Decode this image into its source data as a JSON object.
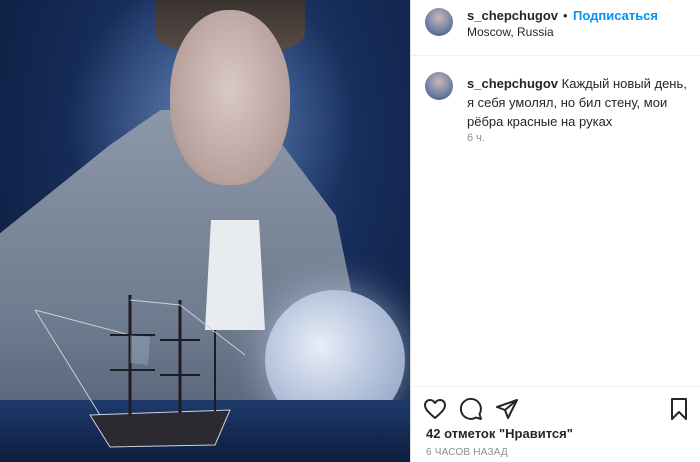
{
  "post": {
    "author": "s_chepchugov",
    "separator": "•",
    "follow_label": "Подписаться",
    "location": "Moscow, Russia"
  },
  "caption": {
    "username": "s_chepchugov",
    "text": "Каждый новый день, я себя умолял, но бил стену, мои рёбра красные на руках",
    "age": "6 ч."
  },
  "actions": {
    "like_icon": "heart-icon",
    "comment_icon": "comment-bubble-icon",
    "share_icon": "paper-plane-icon",
    "save_icon": "bookmark-icon"
  },
  "likes_text": "42 отметок \"Нравится\"",
  "posted_ago": "6 ЧАСОВ НАЗАД",
  "colors": {
    "accent": "#0095f6",
    "text": "#262626",
    "muted": "#8e8e8e"
  }
}
